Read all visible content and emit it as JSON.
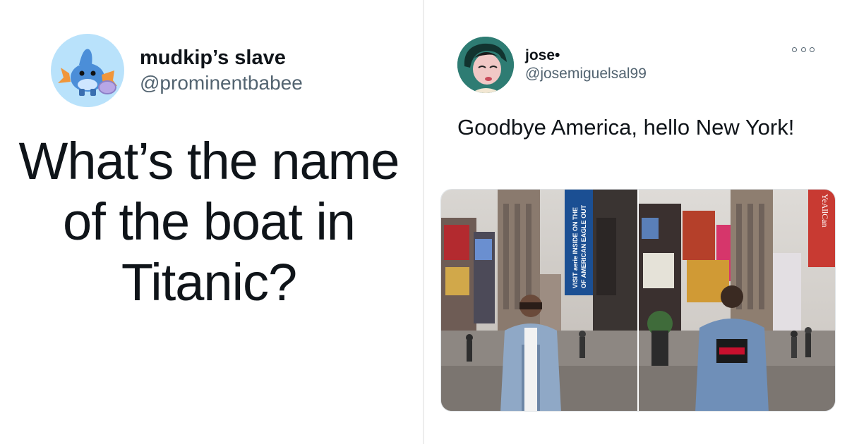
{
  "left_tweet": {
    "display_name": "mudkip’s slave",
    "handle": "@prominentbabee",
    "text": "What’s the name of the boat in Titanic?",
    "avatar": "mudkip-avatar"
  },
  "right_tweet": {
    "display_name": "jose•",
    "handle": "@josemiguelsal99",
    "text": "Goodbye America, hello New York!",
    "avatar": "cartoon-avatar",
    "more_icon": "more-options-icon",
    "photos": [
      {
        "alt": "Man in denim jacket standing in Times Square",
        "banner_text": "VISIT aerie INSIDE ON THE OF AMERICAN EAGLE OUT"
      },
      {
        "alt": "Man in Tommy Jeans denim jacket seen from behind in Times Square",
        "banner_text": "YeAllCan"
      }
    ]
  },
  "colors": {
    "text_primary": "#0f1419",
    "text_secondary": "#536471",
    "divider": "#ededed",
    "avatar_left_bg": "#b9e2fb",
    "avatar_right_bg": "#2e7c73"
  }
}
